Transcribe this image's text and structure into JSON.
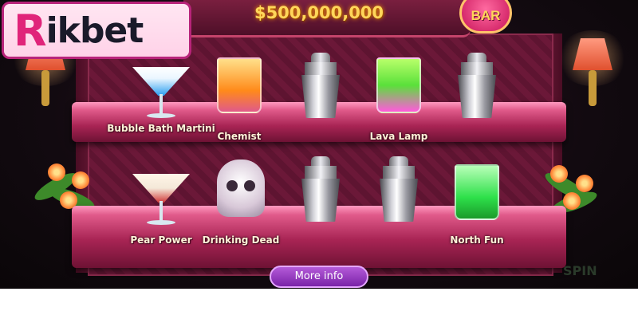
{
  "brand": {
    "logo_first": "R",
    "logo_rest": "ikbet"
  },
  "game": {
    "jackpot": "$500,000,000",
    "bar_badge": "BAR",
    "more_info_button": "More info",
    "background_text": "SPIN"
  },
  "shelves": [
    {
      "items": [
        {
          "name": "Bubble Bath Martini",
          "kind": "martini",
          "color": "#2a9ef0",
          "unlocked": true
        },
        {
          "name": "Chemist",
          "kind": "tumbler",
          "color": "#ff8a1a",
          "unlocked": true
        },
        {
          "name": "",
          "kind": "shaker",
          "unlocked": false
        },
        {
          "name": "Lava Lamp",
          "kind": "tumbler",
          "color": "#7aff3a",
          "unlocked": true
        },
        {
          "name": "",
          "kind": "shaker",
          "unlocked": false
        }
      ]
    },
    {
      "items": [
        {
          "name": "Pear Power",
          "kind": "martini",
          "color": "#f4e8d8",
          "unlocked": true
        },
        {
          "name": "Drinking Dead",
          "kind": "skull",
          "color": "#e8dce8",
          "unlocked": true
        },
        {
          "name": "",
          "kind": "shaker",
          "unlocked": false
        },
        {
          "name": "",
          "kind": "shaker",
          "unlocked": false
        },
        {
          "name": "North Fun",
          "kind": "tumbler",
          "color": "#2ee04a",
          "unlocked": true
        }
      ]
    }
  ],
  "colors": {
    "accent": "#e0247a",
    "shelf": "#a82454",
    "button": "#8a2ab8"
  }
}
